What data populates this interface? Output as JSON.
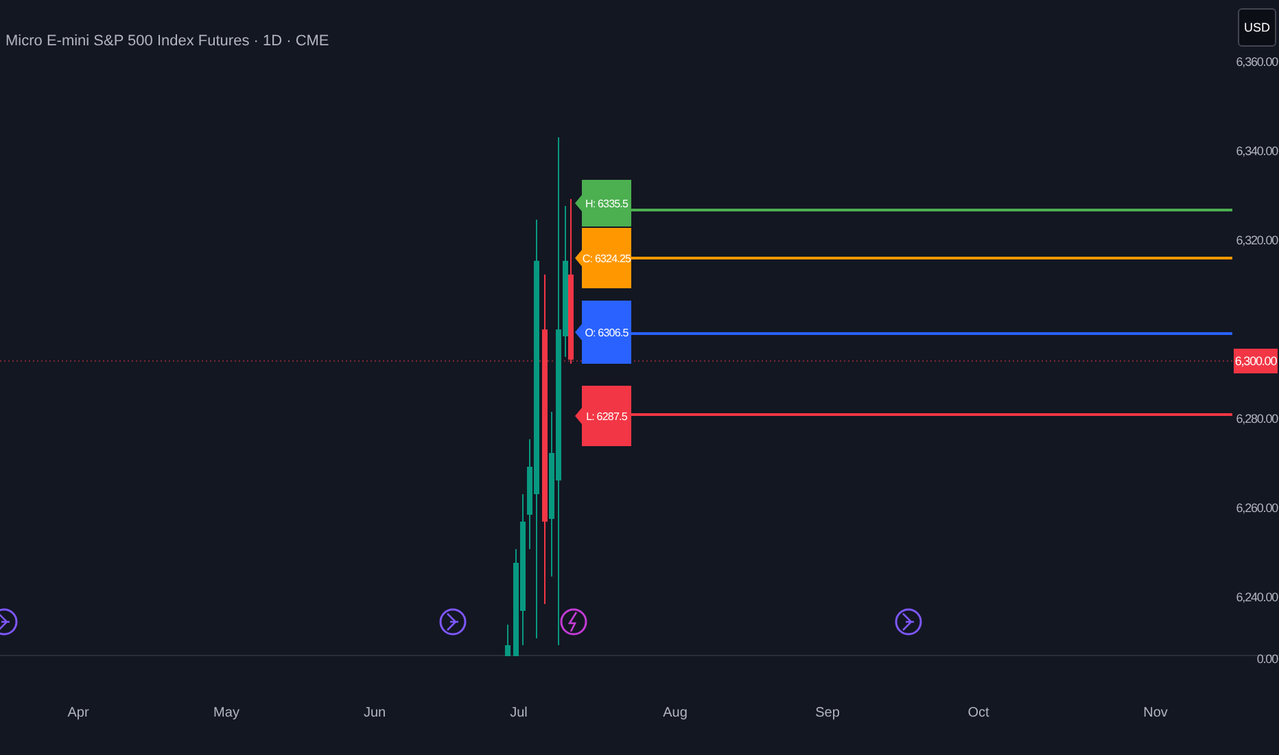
{
  "chart_title": "Micro E-mini S&P 500 Index Futures · 1D · CME",
  "currency": "USD",
  "price_axis": [
    "6,360.00",
    "6,340.00",
    "6,320.00",
    "6,280.00",
    "6,260.00",
    "6,240.00",
    "0.00"
  ],
  "current_price": {
    "label": "6,300.00",
    "color": "#f23645"
  },
  "levels": [
    {
      "label": "H: 6335.5",
      "color": "#4caf50"
    },
    {
      "label": "C: 6324.25",
      "color": "#ff9800"
    },
    {
      "label": "O: 6306.5",
      "color": "#2962ff"
    },
    {
      "label": "L: 6287.5",
      "color": "#f23645"
    }
  ],
  "events": [
    {
      "kind": "arrow"
    },
    {
      "kind": "arrow"
    },
    {
      "kind": "bolt"
    },
    {
      "kind": "arrow"
    }
  ],
  "time_axis": [
    "Apr",
    "May",
    "Jun",
    "Jul",
    "Aug",
    "Sep",
    "Oct",
    "Nov"
  ]
}
